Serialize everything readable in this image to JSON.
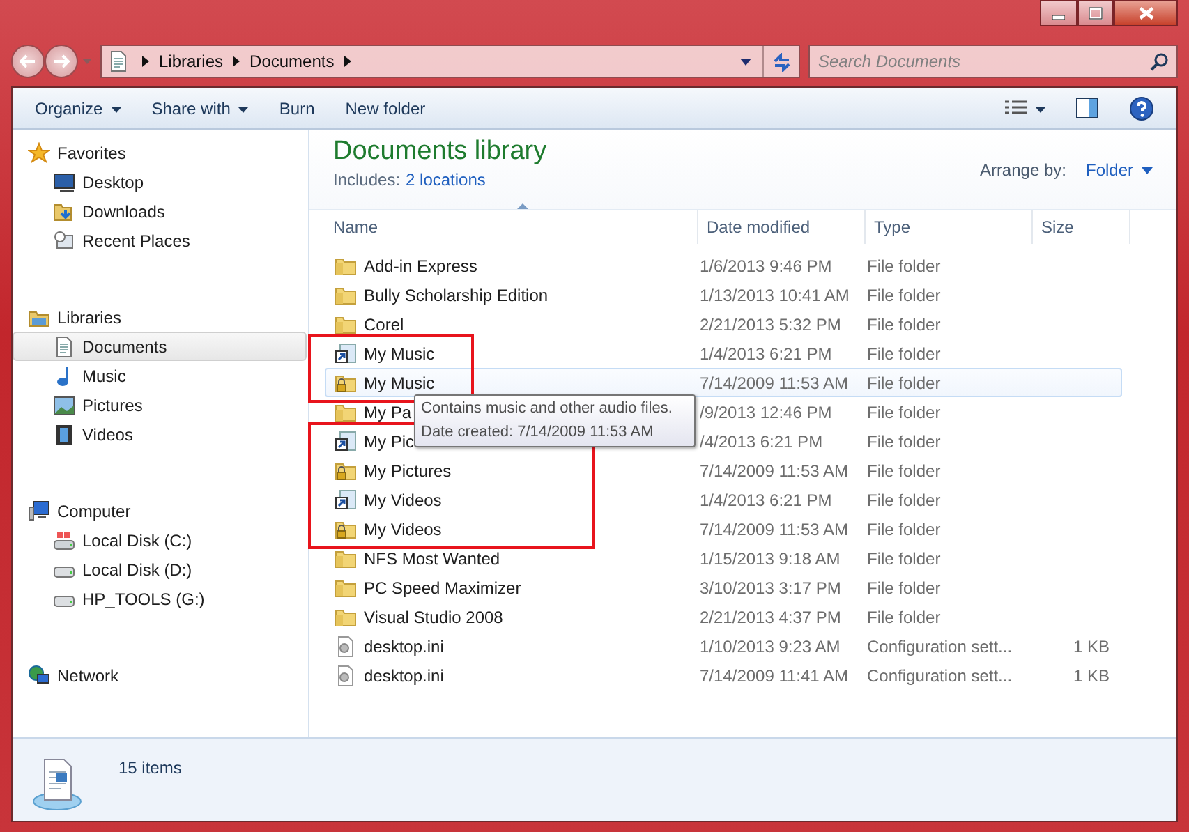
{
  "address_bar": {
    "crumbs": [
      "Libraries",
      "Documents"
    ]
  },
  "search": {
    "placeholder": "Search Documents"
  },
  "toolbar": {
    "buttons": [
      {
        "label": "Organize",
        "dropdown": true
      },
      {
        "label": "Share with",
        "dropdown": true
      },
      {
        "label": "Burn",
        "dropdown": false
      },
      {
        "label": "New folder",
        "dropdown": false
      }
    ]
  },
  "sidebar": {
    "sections": [
      {
        "label": "Favorites",
        "kind": "star",
        "items": [
          {
            "label": "Desktop",
            "kind": "desktop",
            "selected": false
          },
          {
            "label": "Downloads",
            "kind": "downloads",
            "selected": false
          },
          {
            "label": "Recent Places",
            "kind": "recent",
            "selected": false
          }
        ]
      },
      {
        "label": "Libraries",
        "kind": "libraries",
        "items": [
          {
            "label": "Documents",
            "kind": "documents",
            "selected": true
          },
          {
            "label": "Music",
            "kind": "music",
            "selected": false
          },
          {
            "label": "Pictures",
            "kind": "pictures",
            "selected": false
          },
          {
            "label": "Videos",
            "kind": "videos",
            "selected": false
          }
        ]
      },
      {
        "label": "Computer",
        "kind": "computer",
        "items": [
          {
            "label": "Local Disk (C:)",
            "kind": "system-disk",
            "selected": false
          },
          {
            "label": "Local Disk (D:)",
            "kind": "disk",
            "selected": false
          },
          {
            "label": "HP_TOOLS (G:)",
            "kind": "disk",
            "selected": false
          }
        ]
      },
      {
        "label": "Network",
        "kind": "network"
      }
    ]
  },
  "library": {
    "title": "Documents library",
    "includes_label": "Includes:",
    "includes_link": "2 locations",
    "arrange_label": "Arrange by:",
    "arrange_value": "Folder"
  },
  "table": {
    "columns": [
      "Name",
      "Date modified",
      "Type",
      "Size"
    ],
    "rows": [
      {
        "kind": "folder",
        "name": "Add-in Express",
        "date": "1/6/2013 9:46 PM",
        "type": "File folder",
        "selected": false,
        "highlighted": false
      },
      {
        "kind": "folder",
        "name": "Bully Scholarship Edition",
        "date": "1/13/2013 10:41 AM",
        "type": "File folder",
        "selected": false,
        "highlighted": false
      },
      {
        "kind": "folder",
        "name": "Corel",
        "date": "2/21/2013 5:32 PM",
        "type": "File folder",
        "selected": false,
        "highlighted": false
      },
      {
        "kind": "shortcut",
        "name": "My Music",
        "date": "1/4/2013 6:21 PM",
        "type": "File folder",
        "selected": false,
        "highlighted": true
      },
      {
        "kind": "locked",
        "name": "My Music",
        "date": "7/14/2009 11:53 AM",
        "type": "File folder",
        "selected": true,
        "highlighted": true
      },
      {
        "kind": "folder",
        "name": "My Pa",
        "date": "/9/2013 12:46 PM",
        "type": "File folder",
        "selected": false,
        "highlighted": false
      },
      {
        "kind": "shortcut",
        "name": "My Pic",
        "date": "/4/2013 6:21 PM",
        "type": "File folder",
        "selected": false,
        "highlighted": true
      },
      {
        "kind": "locked",
        "name": "My Pictures",
        "date": "7/14/2009 11:53 AM",
        "type": "File folder",
        "selected": false,
        "highlighted": true
      },
      {
        "kind": "shortcut",
        "name": "My Videos",
        "date": "1/4/2013 6:21 PM",
        "type": "File folder",
        "selected": false,
        "highlighted": true
      },
      {
        "kind": "locked",
        "name": "My Videos",
        "date": "7/14/2009 11:53 AM",
        "type": "File folder",
        "selected": false,
        "highlighted": true
      },
      {
        "kind": "folder",
        "name": "NFS Most Wanted",
        "date": "1/15/2013 9:18 AM",
        "type": "File folder",
        "selected": false,
        "highlighted": false
      },
      {
        "kind": "folder",
        "name": "PC Speed Maximizer",
        "date": "3/10/2013 3:17 PM",
        "type": "File folder",
        "selected": false,
        "highlighted": false
      },
      {
        "kind": "folder",
        "name": "Visual Studio 2008",
        "date": "2/21/2013 4:37 PM",
        "type": "File folder",
        "selected": false,
        "highlighted": false
      },
      {
        "kind": "file",
        "name": "desktop.ini",
        "date": "1/10/2013 9:23 AM",
        "type": "Configuration sett...",
        "size": "1 KB",
        "selected": false,
        "highlighted": false
      },
      {
        "kind": "file",
        "name": "desktop.ini",
        "date": "7/14/2009 11:41 AM",
        "type": "Configuration sett...",
        "size": "1 KB",
        "selected": false,
        "highlighted": false
      }
    ]
  },
  "tooltip": {
    "lines": [
      "Contains music and other audio files.",
      "Date created: 7/14/2009 11:53 AM"
    ]
  },
  "status_bar": {
    "count": "15 items"
  }
}
